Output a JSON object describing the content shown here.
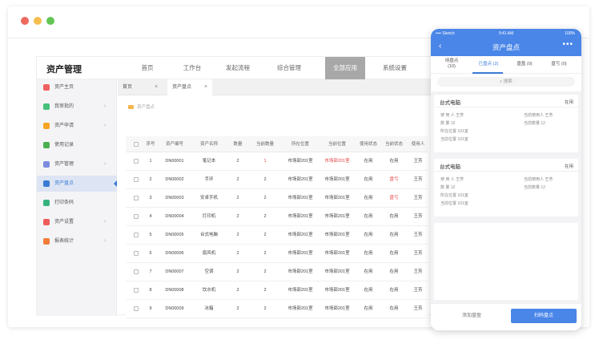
{
  "app": {
    "title": "资产管理",
    "nav": [
      "首页",
      "工作台",
      "发起流程",
      "综合管理",
      "全部应用",
      "系统设置"
    ],
    "active_nav": "全部应用"
  },
  "sidebar": {
    "items": [
      {
        "label": "资产主页",
        "icon": "home-icon",
        "color": "#f06161",
        "chevron": false
      },
      {
        "label": "我审批的",
        "icon": "approve-icon",
        "color": "#46c07a",
        "chevron": true
      },
      {
        "label": "资产申请",
        "icon": "apply-icon",
        "color": "#f5a623",
        "chevron": true
      },
      {
        "label": "使用记录",
        "icon": "record-icon",
        "color": "#4caf50",
        "chevron": false
      },
      {
        "label": "资产管理",
        "icon": "manage-icon",
        "color": "#7e8ce0",
        "chevron": true
      },
      {
        "label": "资产盘点",
        "icon": "inventory-icon",
        "color": "#3a7bd5",
        "chevron": false,
        "active": true
      },
      {
        "label": "打印条码",
        "icon": "barcode-icon",
        "color": "#36b37e",
        "chevron": false
      },
      {
        "label": "资产设置",
        "icon": "settings-icon",
        "color": "#f05a5a",
        "chevron": true
      },
      {
        "label": "报表统计",
        "icon": "report-icon",
        "color": "#f27c3a",
        "chevron": true
      }
    ]
  },
  "tabs": [
    {
      "label": "首页",
      "close": "×"
    },
    {
      "label": "资产盘点",
      "close": "×",
      "active": true
    }
  ],
  "breadcrumb": "资产盘点",
  "table": {
    "headers": [
      "",
      "序号",
      "资产编号",
      "资产名称",
      "数量",
      "当前数量",
      "所在位置",
      "当前位置",
      "使用状态",
      "当前状态",
      "使用人"
    ],
    "rows": [
      {
        "no": "1",
        "code": "DN00001",
        "name": "笔记本",
        "qty": "2",
        "cur_qty": "1",
        "loc": "市场部201室",
        "cur_loc": "市场部201室",
        "status": "在用",
        "cur_status": "在用",
        "user": "王芳",
        "red": [
          "cur_qty",
          "cur_loc"
        ]
      },
      {
        "no": "2",
        "code": "DN00002",
        "name": "手环",
        "qty": "2",
        "cur_qty": "2",
        "loc": "市场部201室",
        "cur_loc": "市场部201室",
        "status": "在用",
        "cur_status": "盘亏",
        "user": "王芳",
        "red": [
          "cur_status"
        ]
      },
      {
        "no": "3",
        "code": "DN00003",
        "name": "安卓手机",
        "qty": "2",
        "cur_qty": "2",
        "loc": "市场部201室",
        "cur_loc": "市场部201室",
        "status": "在用",
        "cur_status": "盘亏",
        "user": "王芳",
        "red": [
          "cur_status"
        ]
      },
      {
        "no": "4",
        "code": "DN00004",
        "name": "打印机",
        "qty": "2",
        "cur_qty": "2",
        "loc": "市场部201室",
        "cur_loc": "市场部201室",
        "status": "在用",
        "cur_status": "在用",
        "user": "王芳",
        "red": []
      },
      {
        "no": "5",
        "code": "DN00005",
        "name": "台式电脑",
        "qty": "2",
        "cur_qty": "2",
        "loc": "市场部201室",
        "cur_loc": "市场部201室",
        "status": "在用",
        "cur_status": "在用",
        "user": "王芳",
        "red": []
      },
      {
        "no": "6",
        "code": "DN00006",
        "name": "扇风机",
        "qty": "2",
        "cur_qty": "2",
        "loc": "市场部201室",
        "cur_loc": "市场部201室",
        "status": "在用",
        "cur_status": "在用",
        "user": "王芳",
        "red": []
      },
      {
        "no": "7",
        "code": "DN00007",
        "name": "空调",
        "qty": "2",
        "cur_qty": "2",
        "loc": "市场部201室",
        "cur_loc": "市场部201室",
        "status": "在用",
        "cur_status": "在用",
        "user": "王芳",
        "red": []
      },
      {
        "no": "8",
        "code": "DN00008",
        "name": "饮水机",
        "qty": "2",
        "cur_qty": "2",
        "loc": "市场部201室",
        "cur_loc": "市场部201室",
        "status": "在用",
        "cur_status": "在用",
        "user": "王芳",
        "red": []
      },
      {
        "no": "9",
        "code": "DN00009",
        "name": "冰箱",
        "qty": "2",
        "cur_qty": "2",
        "loc": "市场部201室",
        "cur_loc": "市场部201室",
        "status": "在用",
        "cur_status": "在用",
        "user": "王芳",
        "red": []
      }
    ]
  },
  "phone": {
    "status_left": "•••• Sketch",
    "status_time": "9:41 AM",
    "status_battery": "100%",
    "title": "资产盘点",
    "back": "‹",
    "more": "•••",
    "tabs": [
      {
        "label": "待盘点",
        "count": "(10)"
      },
      {
        "label": "已盘点",
        "count": "(2)",
        "active": true
      },
      {
        "label": "盘盈",
        "count": "(0)"
      },
      {
        "label": "盘亏",
        "count": "(0)"
      }
    ],
    "search_placeholder": "搜索",
    "cards": [
      {
        "title": "台式电脑",
        "action": "在用",
        "rows": [
          [
            "使 用 人  王芳",
            "当前使用人  王芳"
          ],
          [
            "数      量  12",
            "当前数量  12"
          ],
          [
            "所在位置  101室",
            ""
          ],
          [
            "当前位置  101室",
            ""
          ]
        ]
      },
      {
        "title": "台式电脑",
        "action": "在用",
        "rows": [
          [
            "使 用 人  王芳",
            "当前使用人  王芳"
          ],
          [
            "数      量  12",
            "当前数量  12"
          ],
          [
            "所在位置  101室",
            ""
          ],
          [
            "当前位置  101室",
            ""
          ]
        ]
      }
    ],
    "footer_secondary": "添加盘盈",
    "footer_primary": "扫码盘点"
  },
  "window_controls": {
    "red": "#ee6a5f",
    "yellow": "#f5be4f",
    "green": "#62c554"
  },
  "colors": {
    "accent": "#3a7bd5",
    "danger": "#e64545",
    "phone_header": "#4a86e8"
  }
}
